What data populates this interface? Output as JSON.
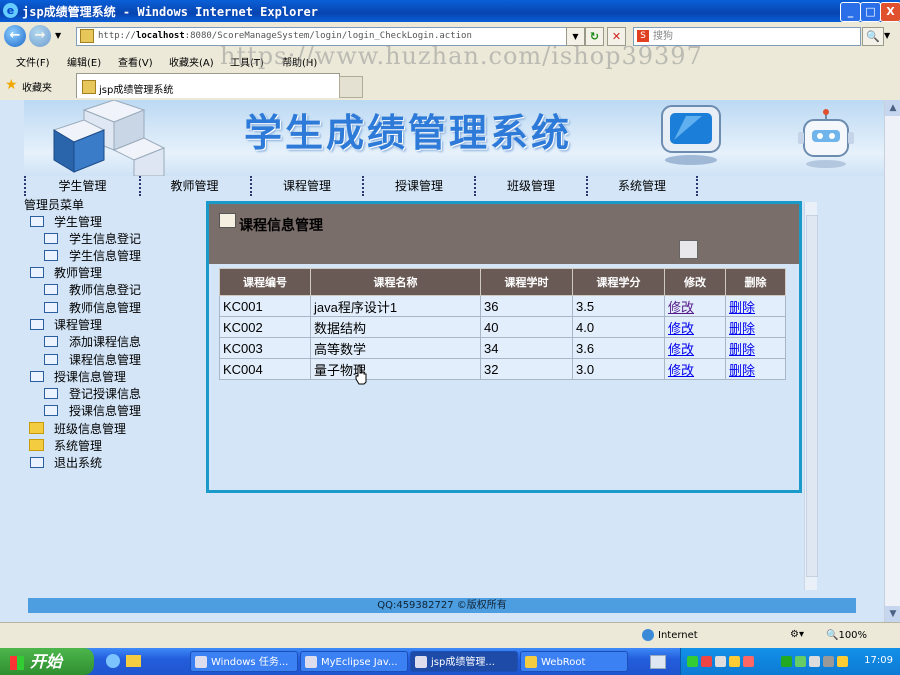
{
  "window": {
    "title": "jsp成绩管理系统 - Windows Internet Explorer",
    "minimize": "_",
    "maximize": "□",
    "close": "X"
  },
  "addressbar": {
    "back": "←",
    "forward": "→",
    "url_prefix": "http://",
    "url_host": "localhost",
    "url_rest": ":8080/ScoreManageSystem/login/login_CheckLogin.action",
    "refresh": "↻",
    "stop": "✕",
    "search_placeholder": "搜狗",
    "search_icon": "S",
    "search_go": "🔍"
  },
  "menubar": {
    "items": [
      "文件(F)",
      "编辑(E)",
      "查看(V)",
      "收藏夹(A)",
      "工具(T)",
      "帮助(H)"
    ]
  },
  "watermark": "https://www.huzhan.com/ishop39397",
  "favbar": {
    "favorites": "收藏夹",
    "tab_title": "jsp成绩管理系统"
  },
  "banner": {
    "title": "学生成绩管理系统"
  },
  "topnav": {
    "items": [
      "学生管理",
      "教师管理",
      "课程管理",
      "授课管理",
      "班级管理",
      "系统管理"
    ]
  },
  "sidebar": {
    "header": "管理员菜单",
    "items": [
      {
        "label": "学生管理",
        "level": 1
      },
      {
        "label": "学生信息登记",
        "level": 2
      },
      {
        "label": "学生信息管理",
        "level": 2
      },
      {
        "label": "教师管理",
        "level": 1
      },
      {
        "label": "教师信息登记",
        "level": 2
      },
      {
        "label": "教师信息管理",
        "level": 2
      },
      {
        "label": "课程管理",
        "level": 1
      },
      {
        "label": "添加课程信息",
        "level": 2
      },
      {
        "label": "课程信息管理",
        "level": 2
      },
      {
        "label": "授课信息管理",
        "level": 1
      },
      {
        "label": "登记授课信息",
        "level": 2
      },
      {
        "label": "授课信息管理",
        "level": 2
      },
      {
        "label": "班级信息管理",
        "level": 1
      },
      {
        "label": "系统管理",
        "level": 1
      },
      {
        "label": "退出系统",
        "level": 1
      }
    ]
  },
  "panel": {
    "title": "课程信息管理",
    "columns": [
      "课程编号",
      "课程名称",
      "课程学时",
      "课程学分",
      "修改",
      "删除"
    ],
    "rows": [
      {
        "id": "KC001",
        "name": "java程序设计1",
        "hours": "36",
        "credit": "3.5",
        "edit": "修改",
        "del": "删除"
      },
      {
        "id": "KC002",
        "name": "数据结构",
        "hours": "40",
        "credit": "4.0",
        "edit": "修改",
        "del": "删除"
      },
      {
        "id": "KC003",
        "name": "高等数学",
        "hours": "34",
        "credit": "3.6",
        "edit": "修改",
        "del": "删除"
      },
      {
        "id": "KC004",
        "name": "量子物理",
        "hours": "32",
        "credit": "3.0",
        "edit": "修改",
        "del": "删除"
      }
    ]
  },
  "footer": "QQ:459382727 ©版权所有",
  "statusbar": {
    "zone": "Internet",
    "zoom": "🔍100%"
  },
  "taskbar": {
    "start": "开始",
    "tasks": [
      "Windows 任务...",
      "MyEclipse Jav...",
      "jsp成绩管理...",
      "WebRoot"
    ],
    "clock": "17:09"
  }
}
